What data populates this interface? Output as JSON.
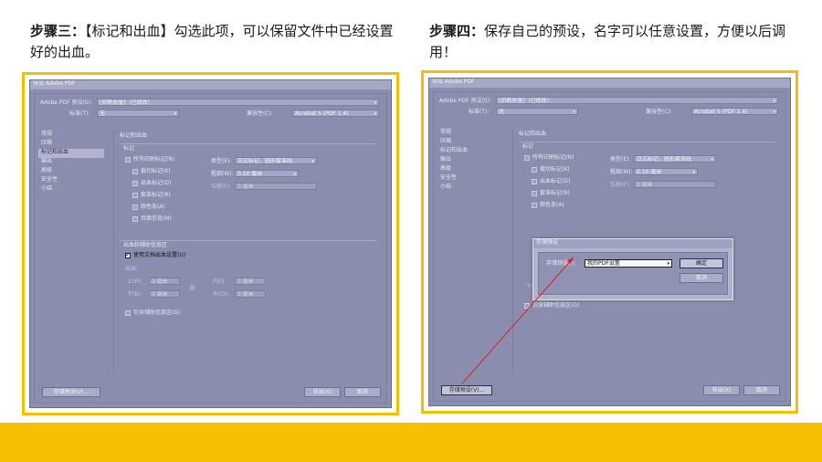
{
  "captions": {
    "left_step": "步骤三：",
    "left_text": "【标记和出血】勾选此项，可以保留文件中已经设置好的出血。",
    "right_step": "步骤四：",
    "right_text": "保存自己的预设，名字可以任意设置，方便以后调用！"
  },
  "dialog": {
    "title": "导出 Adobe PDF",
    "preset_label": "Adobe PDF 预设(S):",
    "preset_value": "[印刷质量]（已修改）",
    "standard_label": "标准(T):",
    "standard_value": "无",
    "compat_label": "兼容性(C):",
    "compat_value": "Acrobat 5 (PDF 1.4)",
    "sidebar": [
      "常规",
      "压缩",
      "标记和出血",
      "输出",
      "高级",
      "安全性",
      "小结"
    ],
    "section_title": "标记和出血",
    "marks_group": "标记",
    "all_marks": "所有印刷标记(N)",
    "crop_marks": "裁切标记(K)",
    "bleed_marks": "出血标记(D)",
    "registration_marks": "套准标记(R)",
    "color_bars": "颜色条(A)",
    "page_info": "页面信息(M)",
    "type_label": "类型(E):",
    "type_value": "日式标记，圆形套准线",
    "weight_label": "粗细(W):",
    "weight_value": "0.10 毫米",
    "offset_label": "位移(F):",
    "offset_value": "3 毫米",
    "bleed_group": "出血和辅助信息区",
    "use_doc_bleed": "使用文档出血设置(U)",
    "bleed_label": "出血:",
    "top_label": "上(P):",
    "bottom_label": "下(B):",
    "inside_label": "内(I):",
    "outside_label": "外(O):",
    "bleed_value": "3 毫米",
    "include_slug": "包含辅助信息区(G)",
    "save_preset": "存储预设(V)...",
    "export": "导出(X)",
    "cancel": "取消"
  },
  "save_popup": {
    "title": "存储预设",
    "label": "存储预设为:",
    "value": "我的PDF设置",
    "ok": "确定",
    "cancel": "取消"
  },
  "colors": {
    "accent": "#f6be00",
    "pointer": "#e02020"
  }
}
